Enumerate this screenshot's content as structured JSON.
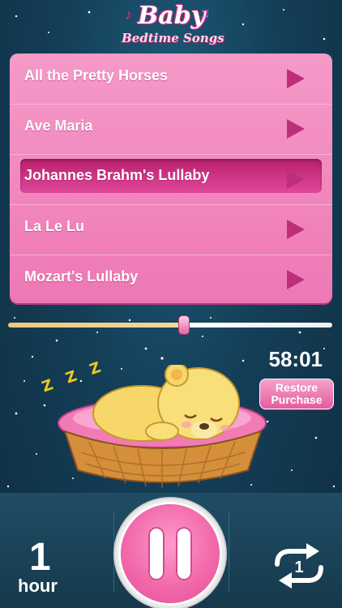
{
  "app": {
    "title_line1": "Baby",
    "title_line2": "Bedtime Songs"
  },
  "songs": [
    {
      "title": "All the Pretty Horses",
      "selected": false
    },
    {
      "title": "Ave Maria",
      "selected": false
    },
    {
      "title": "Johannes Brahm's Lullaby",
      "selected": true
    },
    {
      "title": "La Le Lu",
      "selected": false
    },
    {
      "title": "Mozart's Lullaby",
      "selected": false
    }
  ],
  "volume": {
    "level_fraction": 0.55
  },
  "timer": {
    "remaining": "58:01"
  },
  "restore": {
    "line1": "Restore",
    "line2": "Purchase"
  },
  "sleep": {
    "letters": "Z Z Z"
  },
  "bottom": {
    "duration_value": "1",
    "duration_unit": "hour",
    "repeat_badge": "1"
  },
  "colors": {
    "accent_pink": "#ee78b4",
    "selected_pink": "#b8206d",
    "background": "#143f58",
    "zzz_yellow": "#f2c822"
  },
  "icons": [
    "play-icon",
    "pause-icon",
    "repeat-one-icon",
    "music-note-icon"
  ]
}
